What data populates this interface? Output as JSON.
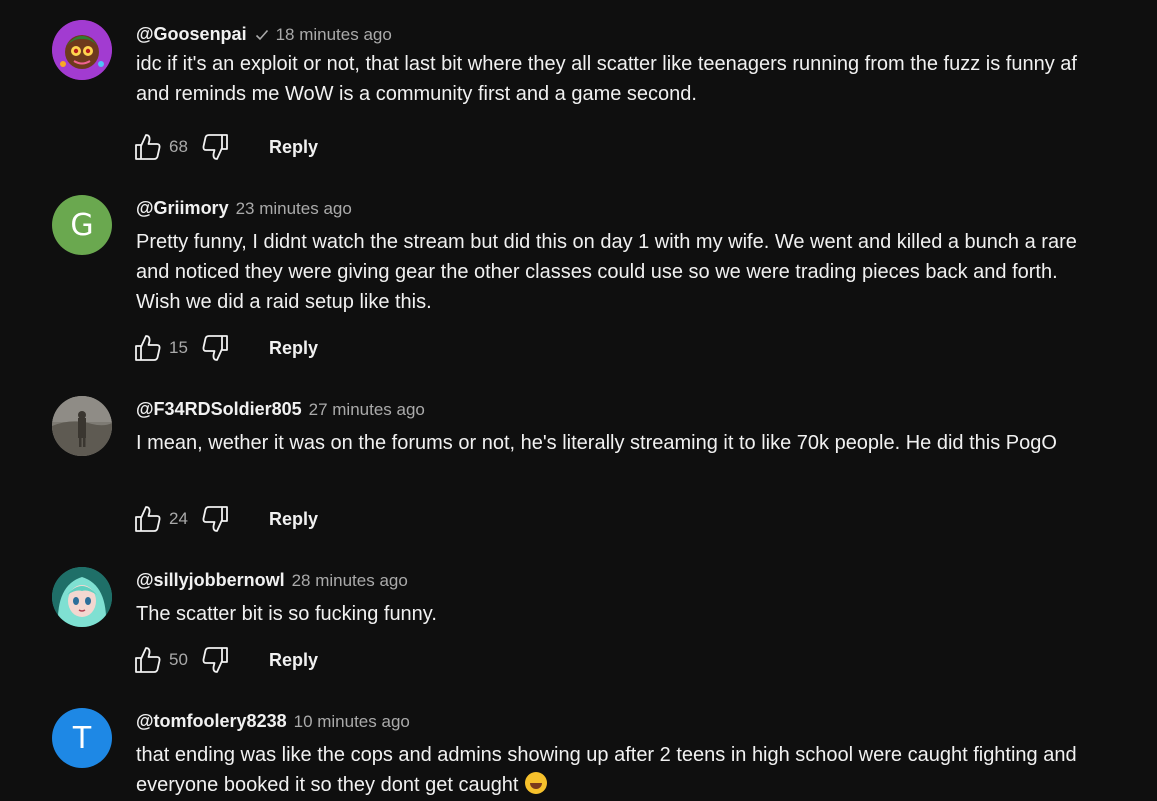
{
  "comments": [
    {
      "author": "@Goosenpai",
      "verified": true,
      "time": "18 minutes ago",
      "text": "idc if it's an exploit or not, that last bit where they all scatter like teenagers running from the fuzz is funny af and reminds me WoW is a community first and a game second.",
      "likes": "68",
      "reply_label": "Reply",
      "avatar_icon": "cartoon-character-avatar"
    },
    {
      "author": "@Griimory",
      "time": "23 minutes ago",
      "text": "Pretty funny, I didnt watch the stream but did this on day 1 with my wife. We went and killed a bunch a rare and noticed they were giving gear the other classes could use so we were trading pieces back and forth. Wish we did a raid setup like this.",
      "likes": "15",
      "reply_label": "Reply",
      "avatar_letter": "G",
      "avatar_color": "#6aa84f"
    },
    {
      "author": "@F34RDSoldier805",
      "time": "27 minutes ago",
      "text": "I mean, wether it was on the forums or not, he's literally streaming it to like 70k people. He did this PogO",
      "likes": "24",
      "reply_label": "Reply",
      "avatar_icon": "soldier-photo-avatar"
    },
    {
      "author": "@sillyjobbernowl",
      "time": "28 minutes ago",
      "text": "The scatter bit is so fucking funny.",
      "likes": "50",
      "reply_label": "Reply",
      "avatar_icon": "anime-character-avatar"
    },
    {
      "author": "@tomfoolery8238",
      "time": "10 minutes ago",
      "text": "that ending was like the cops and admins showing up after 2 teens in high school were caught fighting and everyone booked it so they dont get caught",
      "emoji": "rolling-on-floor-laughing-emoji",
      "avatar_letter": "T",
      "avatar_color": "#1e88e5"
    }
  ]
}
